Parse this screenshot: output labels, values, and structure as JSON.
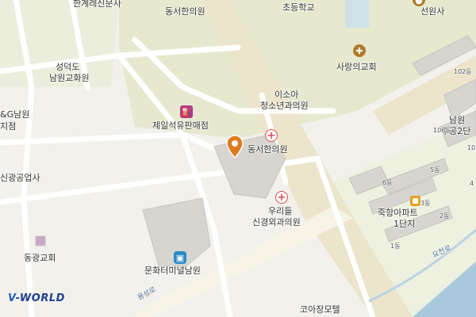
{
  "labels": {
    "hanke_clinic": "한계레신문사",
    "dongseo_clinic_top": "동서한의원",
    "school": "초등학교",
    "seonwonsa": "선원사",
    "seongdeok": "성덕도",
    "namwon_church": "남원교화원",
    "sarang_church": "사랑의교회",
    "isoa_line1": "이소아",
    "isoa_line2": "청소년과의원",
    "jeil": "제일석유판매점",
    "dongseo_clinic": "동서한의원",
    "ng_line1": "&G남원",
    "ng_line2": "지점",
    "singwang": "신광공업사",
    "uri_line1": "우리들",
    "uri_line2": "신경외과의원",
    "dongkwang": "동광교회",
    "terminal": "문화터미널남원",
    "kosha_motel": "코아장모텔",
    "jukhang_line1": "죽항아파트",
    "jukhang_line2": "1단지",
    "namwon_right_line1": "남원",
    "namwon_right_line2": "수공2단",
    "yongseong_road": "용성로",
    "yocheon": "요천로",
    "apt_102": "102동",
    "apt_106": "106동",
    "apt_10": "10",
    "apt_6": "6동",
    "apt_5": "5동",
    "apt_3": "3동",
    "apt_2": "2동",
    "apt_1": "1동",
    "apt_4": "4"
  },
  "logo": {
    "prefix": "V",
    "suffix": "-WORLD"
  },
  "colors": {
    "background": "#f2f1ec",
    "green_area": "#e7e9cf",
    "main_road": "#e9e1c8",
    "building": "#d6d5d0",
    "water": "#a8c9dd",
    "hospital": "#e14b4b",
    "marker": "#e07a1f"
  }
}
